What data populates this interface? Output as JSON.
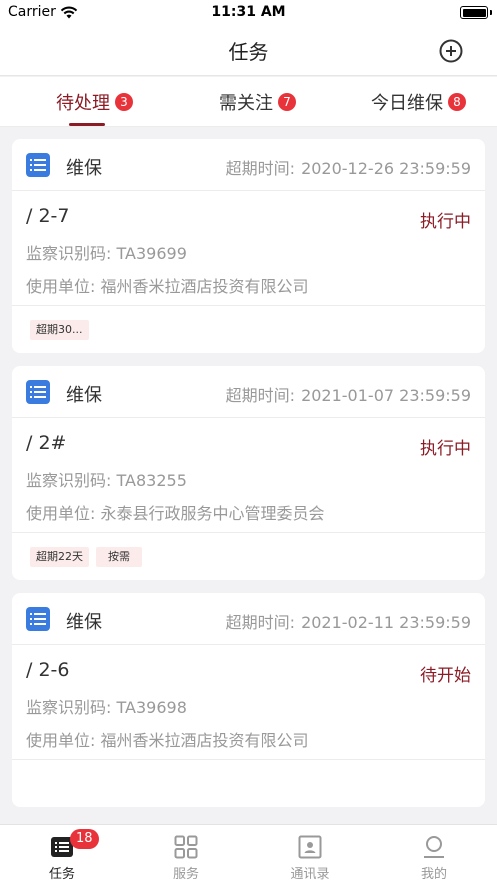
{
  "status_bar": {
    "carrier": "Carrier",
    "time": "11:31 AM"
  },
  "nav": {
    "title": "任务",
    "add_icon": "plus-circle-icon"
  },
  "tabs": [
    {
      "label": "待处理",
      "badge": "3",
      "active": true
    },
    {
      "label": "需关注",
      "badge": "7",
      "active": false
    },
    {
      "label": "今日维保",
      "badge": "8",
      "active": false
    }
  ],
  "cards": [
    {
      "type": "维保",
      "deadline_label": "超期时间:",
      "deadline_value": "2020-12-26 23:59:59",
      "name": "/ 2-7",
      "status": "执行中",
      "code_label": "监察识别码:",
      "code_value": "TA39699",
      "unit_label": "使用单位:",
      "unit_value": "福州香米拉酒店投资有限公司",
      "tags": [
        "超期30..."
      ]
    },
    {
      "type": "维保",
      "deadline_label": "超期时间:",
      "deadline_value": "2021-01-07 23:59:59",
      "name": "/ 2#",
      "status": "执行中",
      "code_label": "监察识别码:",
      "code_value": "TA83255",
      "unit_label": "使用单位:",
      "unit_value": "永泰县行政服务中心管理委员会",
      "tags": [
        "超期22天",
        "按需"
      ]
    },
    {
      "type": "维保",
      "deadline_label": "超期时间:",
      "deadline_value": "2021-02-11 23:59:59",
      "name": "/ 2-6",
      "status": "待开始",
      "code_label": "监察识别码:",
      "code_value": "TA39698",
      "unit_label": "使用单位:",
      "unit_value": "福州香米拉酒店投资有限公司",
      "tags": []
    }
  ],
  "tab_bar": {
    "items": [
      {
        "label": "任务",
        "icon": "task-list-icon",
        "badge": "18",
        "active": true
      },
      {
        "label": "服务",
        "icon": "grid-icon",
        "active": false
      },
      {
        "label": "通讯录",
        "icon": "contacts-icon",
        "active": false
      },
      {
        "label": "我的",
        "icon": "profile-icon",
        "active": false
      }
    ]
  },
  "colors": {
    "accent": "#8b1c26",
    "badge": "#e8333a",
    "type_icon": "#3a7be0",
    "tag_bg": "#fbeceb"
  }
}
